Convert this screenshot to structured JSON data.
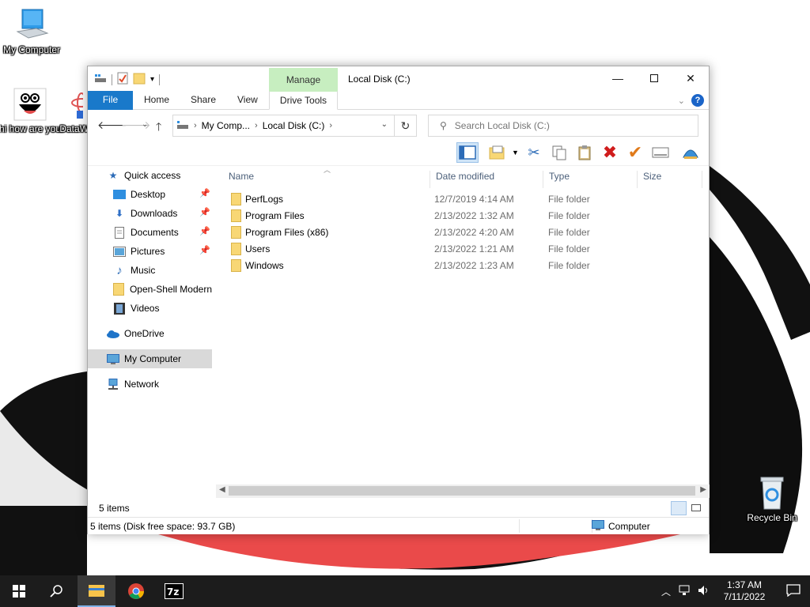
{
  "desktop": {
    "icons": [
      {
        "label": "My Computer"
      },
      {
        "label": "hi how are you"
      },
      {
        "label": "DataW"
      },
      {
        "label": "Recycle Bin"
      }
    ]
  },
  "window": {
    "title": "Local Disk (C:)",
    "manage_tab": "Manage",
    "ribbon_tabs": {
      "file": "File",
      "home": "Home",
      "share": "Share",
      "view": "View",
      "drive_tools": "Drive Tools"
    },
    "help_label": "?",
    "address": {
      "segment1": "My Comp...",
      "segment2": "Local Disk (C:)"
    },
    "search": {
      "placeholder": "Search Local Disk (C:)"
    }
  },
  "nav": {
    "quick_access": "Quick access",
    "items": [
      {
        "label": "Desktop",
        "pinned": true
      },
      {
        "label": "Downloads",
        "pinned": true
      },
      {
        "label": "Documents",
        "pinned": true
      },
      {
        "label": "Pictures",
        "pinned": true
      },
      {
        "label": "Music",
        "pinned": false
      },
      {
        "label": "Open-Shell Modern",
        "pinned": false
      },
      {
        "label": "Videos",
        "pinned": false
      }
    ],
    "onedrive": "OneDrive",
    "my_computer": "My Computer",
    "network": "Network"
  },
  "columns": {
    "name": "Name",
    "date": "Date modified",
    "type": "Type",
    "size": "Size"
  },
  "files": [
    {
      "name": "PerfLogs",
      "date": "12/7/2019 4:14 AM",
      "type": "File folder"
    },
    {
      "name": "Program Files",
      "date": "2/13/2022 1:32 AM",
      "type": "File folder"
    },
    {
      "name": "Program Files (x86)",
      "date": "2/13/2022 4:20 AM",
      "type": "File folder"
    },
    {
      "name": "Users",
      "date": "2/13/2022 1:21 AM",
      "type": "File folder"
    },
    {
      "name": "Windows",
      "date": "2/13/2022 1:23 AM",
      "type": "File folder"
    }
  ],
  "status": {
    "items_count": "5 items",
    "disk_info": "5 items (Disk free space: 93.7 GB)",
    "location": "Computer"
  },
  "taskbar": {
    "time": "1:37 AM",
    "date": "7/11/2022"
  },
  "colors": {
    "accent": "#1979ca",
    "manage": "#c7eec0",
    "taskbar": "#1c1c1c"
  }
}
